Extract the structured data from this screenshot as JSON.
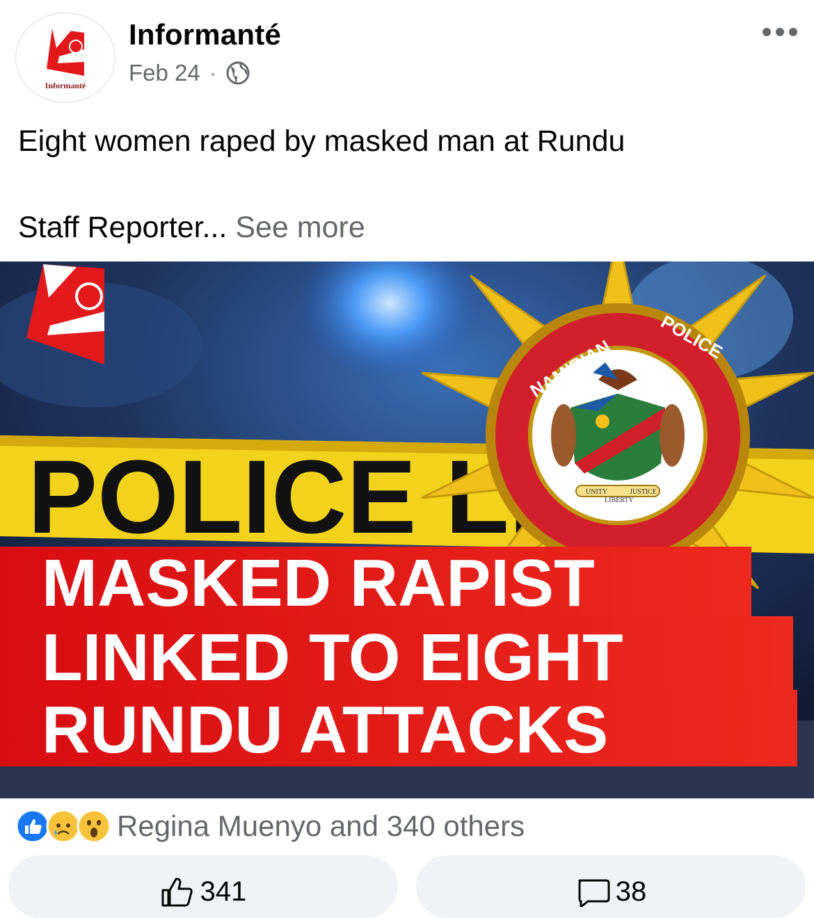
{
  "post": {
    "page_name": "Informanté",
    "avatar_text": "Informanté",
    "date": "Feb 24",
    "privacy_icon": "globe-icon",
    "more_icon": "more-options-icon",
    "text_line1": "Eight women raped by masked man at Rundu",
    "text_line2": "Staff Reporter...",
    "see_more": "See more"
  },
  "image": {
    "tape_text": "POLICE LINE",
    "seal_top_left": "NAMIBIAN",
    "seal_top_right": "POLICE",
    "motto_left": "UNITY",
    "motto_center": "LIBERTY",
    "motto_right": "JUSTICE",
    "headline_line1": "MASKED RAPIST",
    "headline_line2": "LINKED TO EIGHT",
    "headline_line3": "RUNDU ATTACKS"
  },
  "reactions": {
    "icons": [
      "like-reaction-icon",
      "sad-reaction-icon",
      "wow-reaction-icon"
    ],
    "summary": "Regina Muenyo and 340 others"
  },
  "actions": {
    "like_count": "341",
    "comment_count": "38"
  },
  "colors": {
    "brand_red": "#e3191c",
    "gold": "#f2c318",
    "facebook_blue": "#1877f2",
    "secondary_text": "#65676b"
  }
}
